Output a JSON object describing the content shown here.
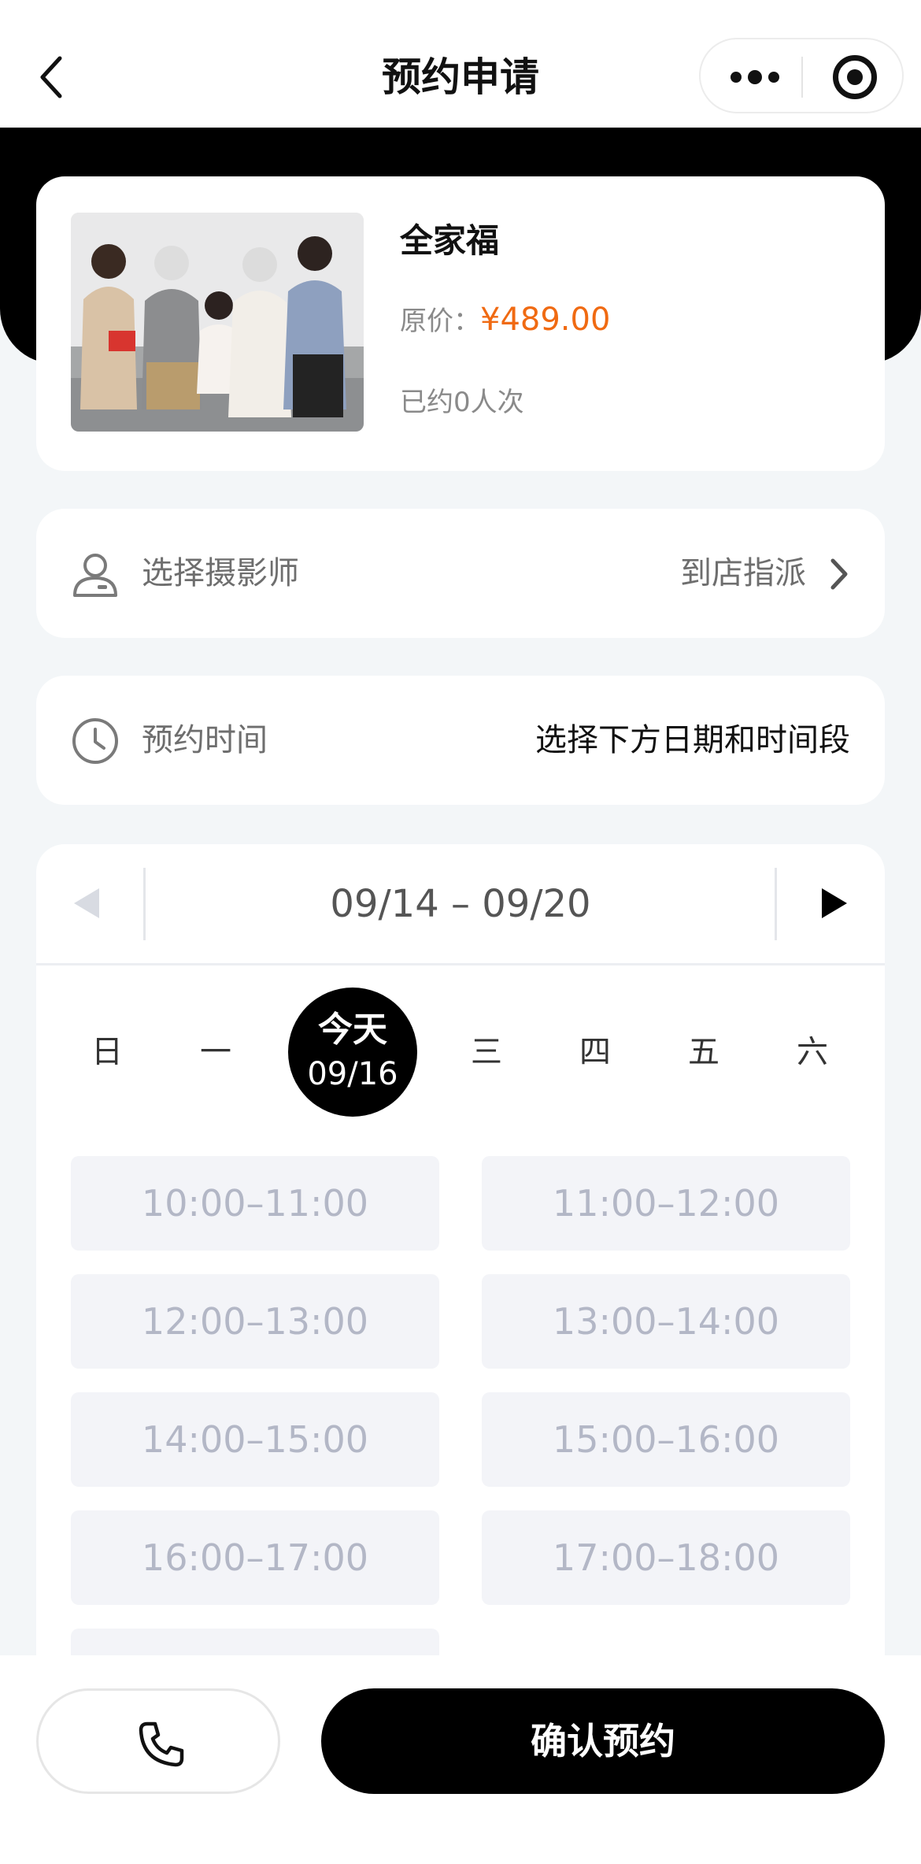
{
  "nav": {
    "title": "预约申请",
    "back_icon": "chevron-left-icon",
    "more_icon": "more-dots-icon",
    "close_icon": "target-circle-icon"
  },
  "product": {
    "name": "全家福",
    "price_label": "原价：",
    "price": "¥489.00",
    "booked": "已约0人次",
    "image": "family-portrait-photo"
  },
  "photographer": {
    "label": "选择摄影师",
    "value": "到店指派",
    "icon": "user-icon"
  },
  "time": {
    "label": "预约时间",
    "value": "选择下方日期和时间段",
    "icon": "clock-icon"
  },
  "calendar": {
    "range": "09/14 – 09/20",
    "days": [
      "日",
      "一",
      "三",
      "四",
      "五",
      "六"
    ],
    "today_label": "今天",
    "today_date": "09/16",
    "slots": [
      "10:00–11:00",
      "11:00–12:00",
      "12:00–13:00",
      "13:00–14:00",
      "14:00–15:00",
      "15:00–16:00",
      "16:00–17:00",
      "17:00–18:00"
    ]
  },
  "footer": {
    "phone_icon": "phone-icon",
    "confirm_label": "确认预约"
  },
  "colors": {
    "accent": "#f06a12",
    "primary": "#000000",
    "slot_bg": "#f3f4f8",
    "slot_text": "#b3b7c6"
  }
}
